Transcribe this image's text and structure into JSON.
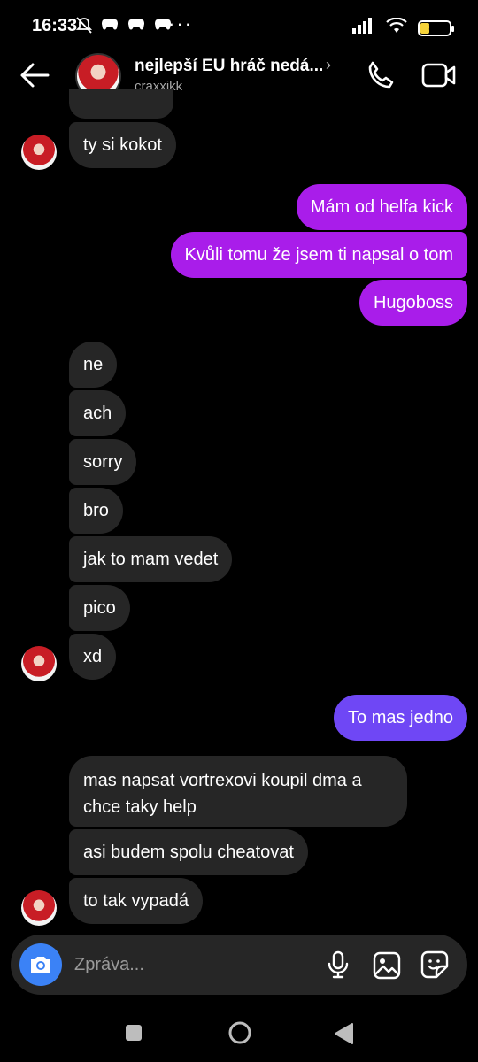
{
  "status_bar": {
    "time": "16:33",
    "battery_level": "30",
    "battery_color": "#f5d33a",
    "left_icons": [
      "muted-bell-icon",
      "game-controller-icon",
      "game-controller-icon",
      "game-controller-icon"
    ],
    "right_icons": [
      "signal-icon",
      "wifi-icon",
      "battery-icon"
    ]
  },
  "header": {
    "title": "nejlepší EU hráč nedá...",
    "subtitle": "craxxikk",
    "icons": [
      "back-arrow-icon",
      "chevron-right-icon",
      "phone-icon",
      "video-camera-icon"
    ]
  },
  "messages": [
    {
      "side": "in",
      "text": "ty si kokot"
    },
    {
      "side": "out",
      "text": "Mám od helfa kick"
    },
    {
      "side": "out",
      "text": "Kvůli tomu že jsem ti napsal o tom"
    },
    {
      "side": "out",
      "text": "Hugoboss"
    },
    {
      "side": "in",
      "text": "ne"
    },
    {
      "side": "in",
      "text": "ach"
    },
    {
      "side": "in",
      "text": "sorry"
    },
    {
      "side": "in",
      "text": "bro"
    },
    {
      "side": "in",
      "text": "jak to mam vedet"
    },
    {
      "side": "in",
      "text": "pico"
    },
    {
      "side": "in",
      "text": "xd"
    },
    {
      "side": "out",
      "text": "To mas jedno"
    },
    {
      "side": "in",
      "text": "mas napsat vortrexovi koupil dma a chce taky help"
    },
    {
      "side": "in",
      "text": "asi budem spolu cheatovat"
    },
    {
      "side": "in",
      "text": "to tak vypadá"
    }
  ],
  "colors": {
    "outgoing_purple": "#a91dea",
    "outgoing_violet": "#6f47f5",
    "incoming": "#262626",
    "camera_button": "#3b82f6"
  },
  "composer": {
    "placeholder": "Zpráva...",
    "icons": [
      "camera-icon",
      "microphone-icon",
      "gallery-icon",
      "sticker-icon"
    ]
  },
  "nav_bar": {
    "icons": [
      "recents-square-icon",
      "home-circle-icon",
      "back-triangle-icon"
    ]
  }
}
